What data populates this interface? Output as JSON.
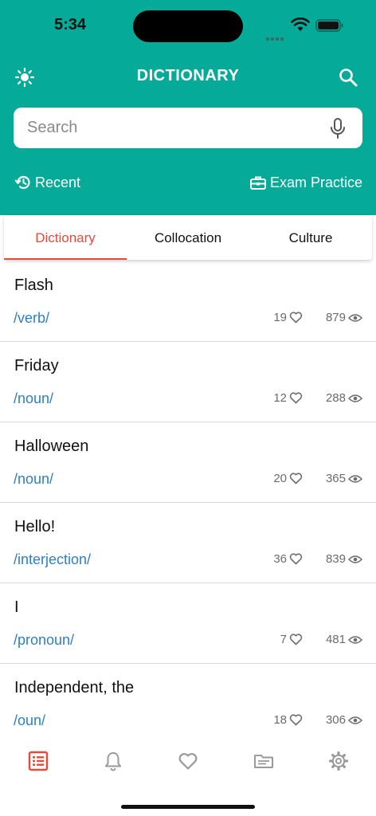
{
  "status_bar": {
    "time": "5:34"
  },
  "header": {
    "title": "DICTIONARY"
  },
  "search": {
    "placeholder": "Search",
    "value": ""
  },
  "quick_links": {
    "recent": "Recent",
    "exam": "Exam Practice"
  },
  "tabs": [
    {
      "label": "Dictionary",
      "active": true
    },
    {
      "label": "Collocation",
      "active": false
    },
    {
      "label": "Culture",
      "active": false
    }
  ],
  "entries": [
    {
      "word": "Flash",
      "pos": "/verb/",
      "likes": "19",
      "views": "879"
    },
    {
      "word": "Friday",
      "pos": "/noun/",
      "likes": "12",
      "views": "288"
    },
    {
      "word": "Halloween",
      "pos": "/noun/",
      "likes": "20",
      "views": "365"
    },
    {
      "word": "Hello!",
      "pos": "/interjection/",
      "likes": "36",
      "views": "839"
    },
    {
      "word": "I",
      "pos": "/pronoun/",
      "likes": "7",
      "views": "481"
    },
    {
      "word": "Independent, the",
      "pos": "/oun/",
      "likes": "18",
      "views": "306"
    }
  ],
  "bottom_nav": [
    {
      "icon": "list-icon",
      "active": true
    },
    {
      "icon": "bell-icon",
      "active": false
    },
    {
      "icon": "heart-icon",
      "active": false
    },
    {
      "icon": "folder-icon",
      "active": false
    },
    {
      "icon": "gear-icon",
      "active": false
    }
  ],
  "colors": {
    "header": "#05aa98",
    "accent": "#e84a3a",
    "link": "#2f7fc1"
  }
}
